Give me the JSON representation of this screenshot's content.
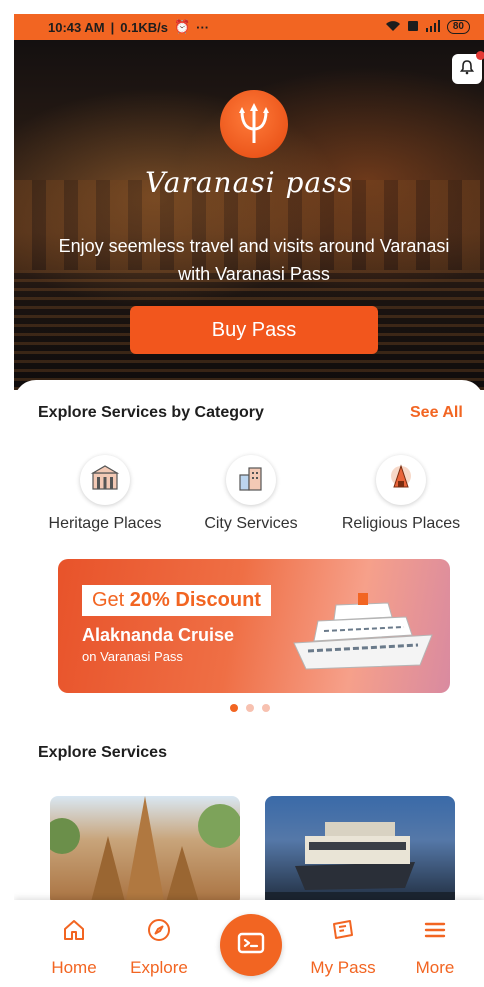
{
  "status_bar": {
    "time": "10:43 AM",
    "speed": "0.1KB/s",
    "more": "···",
    "battery": "80"
  },
  "hero": {
    "logo_text": "Varanasi pass",
    "tagline": "Enjoy seemless travel and visits around Varanasi with Varanasi Pass",
    "buy_button": "Buy Pass"
  },
  "categories": {
    "title": "Explore Services by Category",
    "see_all": "See All",
    "items": [
      {
        "label": "Heritage Places",
        "icon": "heritage-building-icon"
      },
      {
        "label": "City Services",
        "icon": "city-buildings-icon"
      },
      {
        "label": "Religious Places",
        "icon": "temple-icon"
      }
    ]
  },
  "banner": {
    "discount_prefix": "Get ",
    "discount_value": "20% Discount",
    "title": "Alaknanda Cruise",
    "subtitle": "on Varanasi Pass"
  },
  "explore_services": {
    "title": "Explore Services"
  },
  "bottom_nav": {
    "items": [
      {
        "label": "Home",
        "icon": "home-icon"
      },
      {
        "label": "Explore",
        "icon": "compass-icon"
      },
      {
        "label": "My Pass",
        "icon": "pass-ticket-icon"
      },
      {
        "label": "More",
        "icon": "hamburger-menu-icon"
      }
    ],
    "center_icon": "scan-pass-icon"
  },
  "colors": {
    "accent": "#f26522",
    "notification_dot": "#e53935"
  }
}
